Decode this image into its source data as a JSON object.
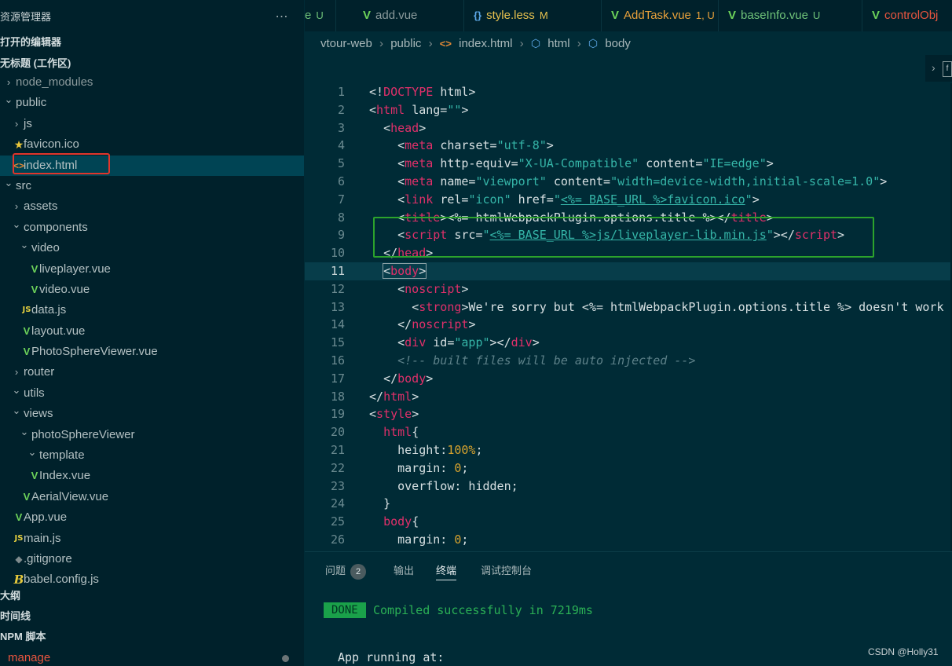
{
  "explorer": {
    "title": "资源管理器",
    "more_icon": "…",
    "sections": {
      "open_editors": "打开的编辑器",
      "workspace": "无标题 (工作区)",
      "outline": "大纲",
      "timeline": "时间线",
      "npm_scripts": "NPM 脚本"
    },
    "tree": [
      {
        "label": "node_modules",
        "depth": 0,
        "chevron": "right",
        "icon": "",
        "dim": true
      },
      {
        "label": "public",
        "depth": 0,
        "chevron": "down",
        "icon": ""
      },
      {
        "label": "js",
        "depth": 1,
        "chevron": "right",
        "icon": ""
      },
      {
        "label": "favicon.ico",
        "depth": 1,
        "chevron": "",
        "icon": "star"
      },
      {
        "label": "index.html",
        "depth": 1,
        "chevron": "",
        "icon": "html",
        "active": true
      },
      {
        "label": "src",
        "depth": 0,
        "chevron": "down",
        "icon": ""
      },
      {
        "label": "assets",
        "depth": 1,
        "chevron": "right",
        "icon": ""
      },
      {
        "label": "components",
        "depth": 1,
        "chevron": "down",
        "icon": ""
      },
      {
        "label": "video",
        "depth": 2,
        "chevron": "down",
        "icon": ""
      },
      {
        "label": "liveplayer.vue",
        "depth": 3,
        "chevron": "",
        "icon": "vue"
      },
      {
        "label": "video.vue",
        "depth": 3,
        "chevron": "",
        "icon": "vue"
      },
      {
        "label": "data.js",
        "depth": 2,
        "chevron": "",
        "icon": "js"
      },
      {
        "label": "layout.vue",
        "depth": 2,
        "chevron": "",
        "icon": "vue"
      },
      {
        "label": "PhotoSphereViewer.vue",
        "depth": 2,
        "chevron": "",
        "icon": "vue"
      },
      {
        "label": "router",
        "depth": 1,
        "chevron": "right",
        "icon": ""
      },
      {
        "label": "utils",
        "depth": 1,
        "chevron": "down",
        "icon": ""
      },
      {
        "label": "views",
        "depth": 1,
        "chevron": "down",
        "icon": ""
      },
      {
        "label": "photoSphereViewer",
        "depth": 2,
        "chevron": "down",
        "icon": ""
      },
      {
        "label": "template",
        "depth": 3,
        "chevron": "down",
        "icon": ""
      },
      {
        "label": "Index.vue",
        "depth": 3,
        "chevron": "",
        "icon": "vue"
      },
      {
        "label": "AerialView.vue",
        "depth": 2,
        "chevron": "",
        "icon": "vue"
      },
      {
        "label": "App.vue",
        "depth": 1,
        "chevron": "",
        "icon": "vue"
      },
      {
        "label": "main.js",
        "depth": 1,
        "chevron": "",
        "icon": "js"
      },
      {
        "label": ".gitignore",
        "depth": 1,
        "chevron": "",
        "icon": "git"
      },
      {
        "label": "babel.config.js",
        "depth": 1,
        "chevron": "",
        "icon": "babel"
      }
    ],
    "npm_item": "manage"
  },
  "icons": {
    "vue": "V",
    "js": "JS",
    "star": "★",
    "html": "<>",
    "git": "◆",
    "babel": "B",
    "chev_right": "›",
    "chev_down": "⌄"
  },
  "tabs": [
    {
      "label": "e",
      "mark": "U",
      "kind": "vue-partial"
    },
    {
      "label": "add.vue",
      "mark": "",
      "kind": "vue"
    },
    {
      "label": "style.less",
      "mark": "M",
      "kind": "less"
    },
    {
      "label": "AddTask.vue",
      "mark": "1, U",
      "kind": "vue"
    },
    {
      "label": "baseInfo.vue",
      "mark": "U",
      "kind": "vue"
    },
    {
      "label": "controlObj",
      "mark": "",
      "kind": "vue"
    }
  ],
  "breadcrumb": {
    "items": [
      "vtour-web",
      "public",
      "index.html",
      "html",
      "body"
    ],
    "sep": "›"
  },
  "mini_widget": {
    "label": "f"
  },
  "editor": {
    "current_line": 11,
    "lines": [
      {
        "n": 1,
        "html": "<span class=\"at\">&lt;!</span><span class=\"tg\">DOCTYPE</span> <span class=\"at\">html&gt;</span>"
      },
      {
        "n": 2,
        "html": "<span class=\"at\">&lt;</span><span class=\"tg\">html</span> <span class=\"at\">lang=</span><span class=\"st\">\"\"</span><span class=\"at\">&gt;</span>"
      },
      {
        "n": 3,
        "html": "  <span class=\"at\">&lt;</span><span class=\"tg\">head</span><span class=\"at\">&gt;</span>"
      },
      {
        "n": 4,
        "html": "    <span class=\"at\">&lt;</span><span class=\"tg\">meta</span> <span class=\"at\">charset=</span><span class=\"st\">\"utf-8\"</span><span class=\"at\">&gt;</span>"
      },
      {
        "n": 5,
        "html": "    <span class=\"at\">&lt;</span><span class=\"tg\">meta</span> <span class=\"at\">http-equiv=</span><span class=\"st\">\"X-UA-Compatible\"</span> <span class=\"at\">content=</span><span class=\"st\">\"IE=edge\"</span><span class=\"at\">&gt;</span>"
      },
      {
        "n": 6,
        "html": "    <span class=\"at\">&lt;</span><span class=\"tg\">meta</span> <span class=\"at\">name=</span><span class=\"st\">\"viewport\"</span> <span class=\"at\">content=</span><span class=\"st\">\"width=device-width,initial-scale=1.0\"</span><span class=\"at\">&gt;</span>"
      },
      {
        "n": 7,
        "html": "    <span class=\"at\">&lt;</span><span class=\"tg\">link</span> <span class=\"at\">rel=</span><span class=\"st\">\"icon\"</span> <span class=\"at\">href=</span><span class=\"st\">\"<span class=\"ul\">&lt;%= BASE_URL %&gt;favicon.ico</span>\"</span><span class=\"at\">&gt;</span>"
      },
      {
        "n": 8,
        "html": "    <span class=\"at\">&lt;</span><span class=\"tg\">title</span><span class=\"at\">&gt;&lt;%= htmlWebpackPlugin.options.title %&gt;&lt;/</span><span class=\"tg\">title</span><span class=\"at\">&gt;</span>"
      },
      {
        "n": 9,
        "html": "    <span class=\"at\">&lt;</span><span class=\"tg\">script</span> <span class=\"at\">src=</span><span class=\"st\">\"<span class=\"ul\">&lt;%= BASE_URL %&gt;js/liveplayer-lib.min.js</span>\"</span><span class=\"at\">&gt;&lt;/</span><span class=\"tg\">script</span><span class=\"at\">&gt;</span>"
      },
      {
        "n": 10,
        "html": "  <span class=\"at\">&lt;/</span><span class=\"tg\">head</span><span class=\"at\">&gt;</span>"
      },
      {
        "n": 11,
        "html": "  <span class=\"bracket-box\"><span class=\"at\">&lt;</span><span class=\"tg\">body</span><span class=\"at\">&gt;</span></span>"
      },
      {
        "n": 12,
        "html": "    <span class=\"at\">&lt;</span><span class=\"tg\">noscript</span><span class=\"at\">&gt;</span>"
      },
      {
        "n": 13,
        "html": "      <span class=\"at\">&lt;</span><span class=\"tg\">strong</span><span class=\"at\">&gt;We're sorry but &lt;%= htmlWebpackPlugin.options.title %&gt; doesn't work</span>"
      },
      {
        "n": 14,
        "html": "    <span class=\"at\">&lt;/</span><span class=\"tg\">noscript</span><span class=\"at\">&gt;</span>"
      },
      {
        "n": 15,
        "html": "    <span class=\"at\">&lt;</span><span class=\"tg\">div</span> <span class=\"at\">id=</span><span class=\"st\">\"app\"</span><span class=\"at\">&gt;&lt;/</span><span class=\"tg\">div</span><span class=\"at\">&gt;</span>"
      },
      {
        "n": 16,
        "html": "    <span class=\"cm\">&lt;!-- built files will be auto injected --&gt;</span>"
      },
      {
        "n": 17,
        "html": "  <span class=\"at\">&lt;/</span><span class=\"tg\">body</span><span class=\"at\">&gt;</span>"
      },
      {
        "n": 18,
        "html": "<span class=\"at\">&lt;/</span><span class=\"tg\">html</span><span class=\"at\">&gt;</span>"
      },
      {
        "n": 19,
        "html": "<span class=\"at\">&lt;</span><span class=\"tg\">style</span><span class=\"at\">&gt;</span>"
      },
      {
        "n": 20,
        "html": "  <span class=\"tg\">html</span><span class=\"at\">{</span>"
      },
      {
        "n": 21,
        "html": "    <span class=\"at\">height:</span><span class=\"num\">100%</span><span class=\"at\">;</span>"
      },
      {
        "n": 22,
        "html": "    <span class=\"at\">margin: </span><span class=\"num\">0</span><span class=\"at\">;</span>"
      },
      {
        "n": 23,
        "html": "    <span class=\"at\">overflow: hidden;</span>"
      },
      {
        "n": 24,
        "html": "  <span class=\"at\">}</span>"
      },
      {
        "n": 25,
        "html": "  <span class=\"tg\">body</span><span class=\"at\">{</span>"
      },
      {
        "n": 26,
        "html": "    <span class=\"at\">margin: </span><span class=\"num\">0</span><span class=\"at\">;</span>"
      }
    ]
  },
  "panel": {
    "tabs": [
      {
        "label": "问题",
        "badge": "2"
      },
      {
        "label": "输出",
        "badge": ""
      },
      {
        "label": "终端",
        "badge": "",
        "active": true
      },
      {
        "label": "调试控制台",
        "badge": ""
      }
    ],
    "terminal": {
      "badge": "DONE",
      "message": "Compiled successfully in 7219ms",
      "running": "App running at:"
    }
  },
  "watermark": "CSDN @Holly31",
  "colors": {
    "sidebar_bg": "#00212b",
    "editor_bg": "#002b36",
    "active_row": "#004454",
    "tag": "#e0306a",
    "string": "#35b5a8",
    "vue_icon": "#6dd35a",
    "done_bg": "#1aa14a",
    "annotation_red": "#e1352b",
    "annotation_green": "#2ca32c"
  }
}
